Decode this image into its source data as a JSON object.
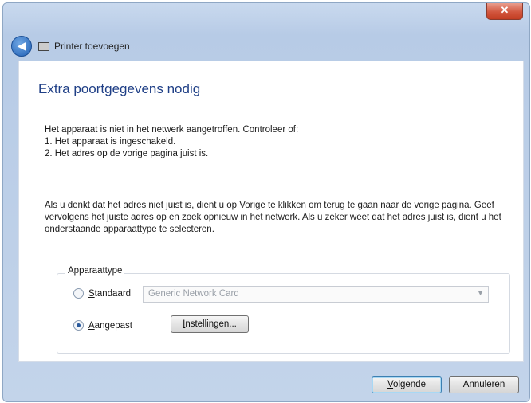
{
  "window": {
    "title": "Printer toevoegen",
    "close_label": "✕",
    "back_glyph": "◀"
  },
  "page": {
    "heading": "Extra poortgegevens nodig",
    "para1_line1": "Het apparaat is niet in het netwerk aangetroffen. Controleer of:",
    "para1_line2": "1. Het apparaat is ingeschakeld.",
    "para1_line3": "2. Het adres op de vorige pagina juist is.",
    "para2": "Als u denkt dat het adres niet juist is, dient u op Vorige te klikken om terug te gaan naar de vorige pagina. Geef vervolgens het juiste adres op en zoek opnieuw in het netwerk. Als u zeker weet dat het adres juist is, dient u het onderstaande apparaattype te selecteren."
  },
  "device_type": {
    "legend": "Apparaattype",
    "standard_label": "Standaard",
    "standard_mnemonic": "S",
    "standard_rest": "tandaard",
    "standard_selected_value": "Generic Network Card",
    "custom_label": "Aangepast",
    "custom_mnemonic": "A",
    "custom_rest": "angepast",
    "selected": "custom",
    "settings_mnemonic": "I",
    "settings_rest": "nstellingen..."
  },
  "buttons": {
    "next_mnemonic": "V",
    "next_rest": "olgende",
    "cancel": "Annuleren"
  },
  "icons": {
    "back": "back-arrow-icon",
    "printer": "printer-icon",
    "dropdown": "chevron-down-icon"
  }
}
